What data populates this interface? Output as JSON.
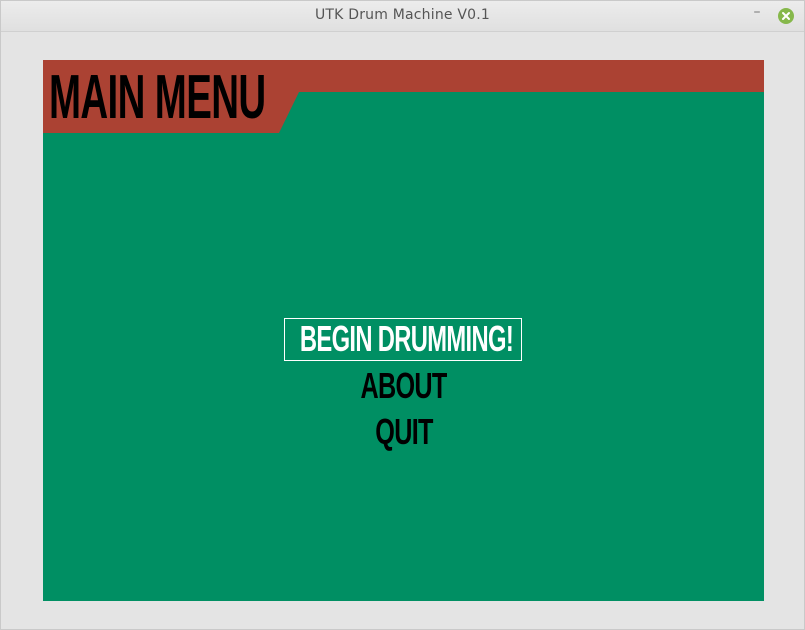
{
  "window": {
    "title": "UTK Drum Machine V0.1",
    "minimize_glyph": "–"
  },
  "header": {
    "title": "MAIN MENU"
  },
  "menu": {
    "items": [
      {
        "label": "BEGIN DRUMMING!",
        "selected": true
      },
      {
        "label": "ABOUT",
        "selected": false
      },
      {
        "label": "QUIT",
        "selected": false
      }
    ]
  },
  "colors": {
    "background": "#008f63",
    "header_banner": "#ab4233",
    "selected_text": "#ffffff",
    "menu_text": "#000000"
  },
  "icons": {
    "minimize": "minimize-icon",
    "close": "close-icon"
  }
}
